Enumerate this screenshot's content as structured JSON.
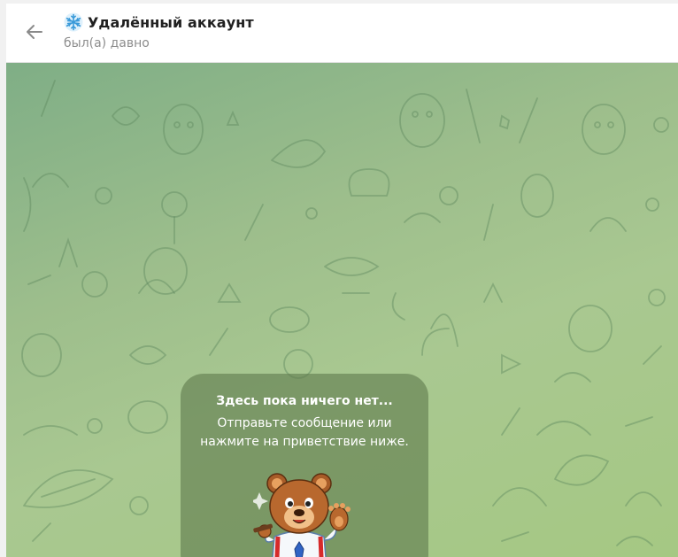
{
  "header": {
    "title": "Удалённый аккаунт",
    "status": "был(а) давно",
    "back_icon": "arrow-left-icon",
    "avatar_icon": "snowflake-icon"
  },
  "empty_state": {
    "title": "Здесь пока ничего нет...",
    "text": "Отправьте сообщение или нажмите на приветствие ниже.",
    "sticker": "bear-greeting-sticker"
  },
  "colors": {
    "chat_background": "#9dbe8c",
    "card_background": "#607a4e",
    "accent": "#4aa3df"
  }
}
